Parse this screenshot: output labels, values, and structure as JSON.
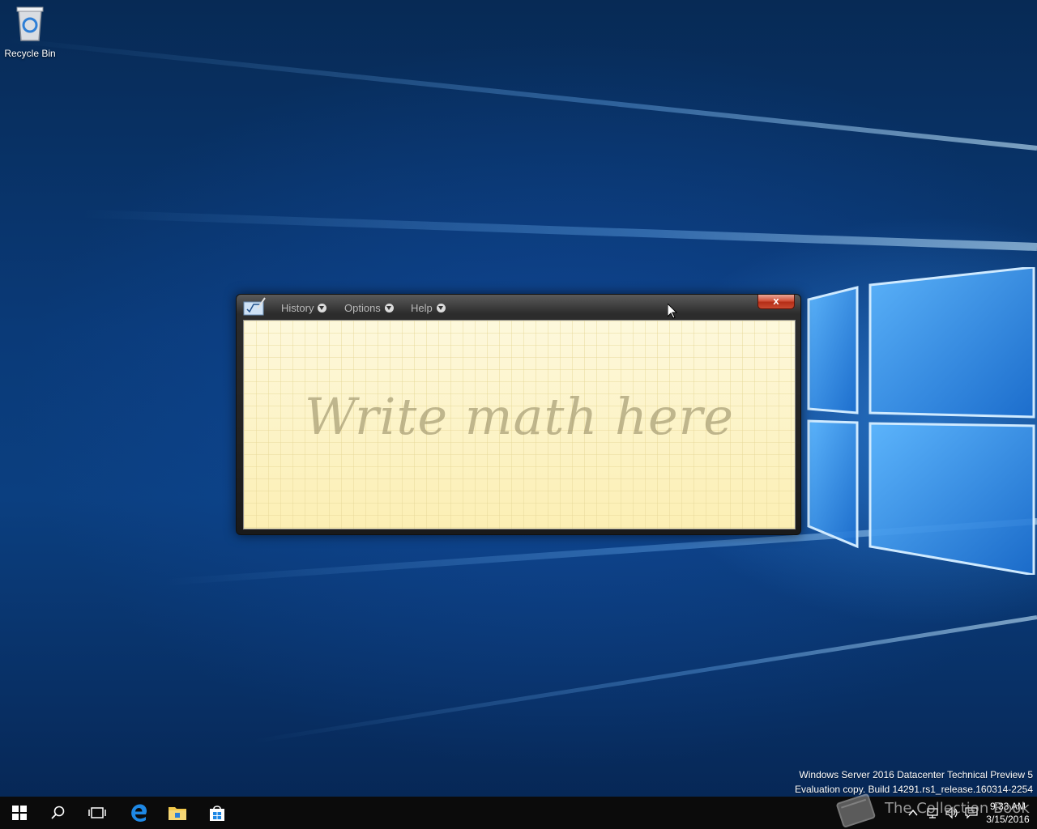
{
  "desktop": {
    "recycle_bin_label": "Recycle Bin",
    "watermark": {
      "line1": "Windows Server 2016 Datacenter Technical Preview 5",
      "line2": "Evaluation copy. Build 14291.rs1_release.160314-2254"
    },
    "collection_text": "The Collection Book"
  },
  "math_panel": {
    "menus": [
      {
        "label": "History"
      },
      {
        "label": "Options"
      },
      {
        "label": "Help"
      }
    ],
    "close_label": "x",
    "placeholder": "Write math here"
  },
  "taskbar": {
    "icons": [
      "windows-start-icon",
      "search-icon",
      "task-view-icon",
      "edge-icon",
      "file-explorer-icon",
      "store-icon"
    ],
    "clock": {
      "time": "9:33 AM",
      "date": "3/15/2016"
    }
  },
  "colors": {
    "taskbar": "#0b0b0b",
    "writing_area": "#fdf6cc",
    "close_button": "#c94a30",
    "accent_blue": "#1e88e5"
  }
}
